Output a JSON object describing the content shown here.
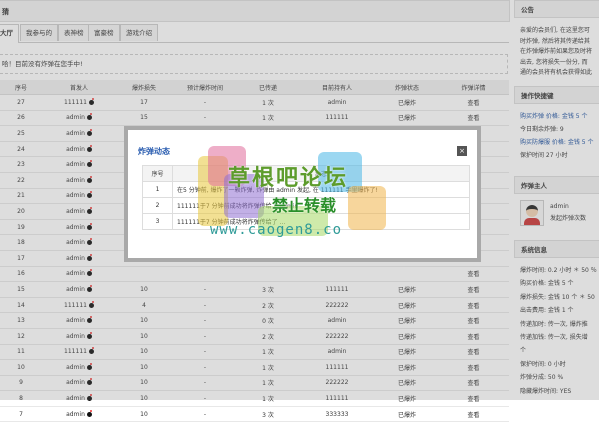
{
  "main": {
    "header": "猜",
    "tabs": [
      "大厅",
      "我参与的",
      "表神榜",
      "富豪榜",
      "游戏介绍"
    ],
    "notice": "哈！目前没有炸弹在您手中!",
    "columns": [
      "序号",
      "首发人",
      "爆炸损失",
      "预计爆炸时间",
      "已传递",
      "目前持有人",
      "炸弹状态",
      "炸弹详情"
    ],
    "rows": [
      {
        "id": "27",
        "starter": "111111",
        "loss": "17",
        "time": "-",
        "passed": "1 次",
        "holder": "admin",
        "status": "已爆炸",
        "detail": "查看"
      },
      {
        "id": "26",
        "starter": "admin",
        "loss": "15",
        "time": "-",
        "passed": "1 次",
        "holder": "111111",
        "status": "已爆炸",
        "detail": "查看"
      },
      {
        "id": "25",
        "starter": "admin",
        "loss": "",
        "time": "",
        "passed": "",
        "holder": "",
        "status": "",
        "detail": "查看"
      },
      {
        "id": "24",
        "starter": "admin",
        "loss": "",
        "time": "",
        "passed": "",
        "holder": "",
        "status": "",
        "detail": "查看"
      },
      {
        "id": "23",
        "starter": "admin",
        "loss": "",
        "time": "",
        "passed": "",
        "holder": "",
        "status": "",
        "detail": "查看"
      },
      {
        "id": "22",
        "starter": "admin",
        "loss": "",
        "time": "",
        "passed": "",
        "holder": "",
        "status": "",
        "detail": "查看"
      },
      {
        "id": "21",
        "starter": "admin",
        "loss": "",
        "time": "",
        "passed": "",
        "holder": "",
        "status": "",
        "detail": "查看"
      },
      {
        "id": "20",
        "starter": "admin",
        "loss": "",
        "time": "",
        "passed": "",
        "holder": "",
        "status": "",
        "detail": "查看"
      },
      {
        "id": "19",
        "starter": "admin",
        "loss": "",
        "time": "",
        "passed": "",
        "holder": "",
        "status": "",
        "detail": "查看"
      },
      {
        "id": "18",
        "starter": "admin",
        "loss": "",
        "time": "",
        "passed": "",
        "holder": "",
        "status": "",
        "detail": "查看"
      },
      {
        "id": "17",
        "starter": "admin",
        "loss": "",
        "time": "",
        "passed": "",
        "holder": "",
        "status": "",
        "detail": "查看"
      },
      {
        "id": "16",
        "starter": "admin",
        "loss": "",
        "time": "",
        "passed": "",
        "holder": "",
        "status": "",
        "detail": "查看"
      },
      {
        "id": "15",
        "starter": "admin",
        "loss": "10",
        "time": "-",
        "passed": "3 次",
        "holder": "111111",
        "status": "已爆炸",
        "detail": "查看"
      },
      {
        "id": "14",
        "starter": "111111",
        "loss": "4",
        "time": "-",
        "passed": "2 次",
        "holder": "222222",
        "status": "已爆炸",
        "detail": "查看"
      },
      {
        "id": "13",
        "starter": "admin",
        "loss": "10",
        "time": "-",
        "passed": "0 次",
        "holder": "admin",
        "status": "已爆炸",
        "detail": "查看"
      },
      {
        "id": "12",
        "starter": "admin",
        "loss": "10",
        "time": "-",
        "passed": "2 次",
        "holder": "222222",
        "status": "已爆炸",
        "detail": "查看"
      },
      {
        "id": "11",
        "starter": "111111",
        "loss": "10",
        "time": "-",
        "passed": "1 次",
        "holder": "admin",
        "status": "已爆炸",
        "detail": "查看"
      },
      {
        "id": "10",
        "starter": "admin",
        "loss": "10",
        "time": "-",
        "passed": "1 次",
        "holder": "111111",
        "status": "已爆炸",
        "detail": "查看"
      },
      {
        "id": "9",
        "starter": "admin",
        "loss": "10",
        "time": "-",
        "passed": "1 次",
        "holder": "222222",
        "status": "已爆炸",
        "detail": "查看"
      },
      {
        "id": "8",
        "starter": "admin",
        "loss": "10",
        "time": "-",
        "passed": "1 次",
        "holder": "111111",
        "status": "已爆炸",
        "detail": "查看"
      },
      {
        "id": "7",
        "starter": "admin",
        "loss": "10",
        "time": "-",
        "passed": "3 次",
        "holder": "333333",
        "status": "已爆炸",
        "detail": "查看"
      }
    ]
  },
  "side": {
    "announce_title": "公告",
    "announce_lines": [
      "亲爱的会员们, 在这里您可",
      "时炸弹, 然后将其传递给其",
      "在炸弹爆炸前如果您及时将",
      "出去, 您将损失一份分, 而",
      "通的会员将有机会获得如此"
    ],
    "quick_title": "操作快捷键",
    "quick_lines": [
      "购买炸弹 价格: 金钱 5 个",
      "今日剩余炸弹: 9",
      "购买防爆服 价格: 金钱 5 个",
      "保护时间 27 小时"
    ],
    "quick_links": [
      "购买炸弹",
      "购买防爆服"
    ],
    "holder_title": "炸弹主人",
    "holder_name": "admin",
    "holder_sub": "发起炸弹次数",
    "sys_title": "系统信息",
    "sys_lines": [
      "爆炸时间: 0.2 小时 ＊ 50 ％",
      "购买价格: 金钱 5 个",
      "爆炸损失: 金钱 10 个 ＊ 50",
      "出击费用: 金钱 1 个",
      "传递加时: 传一次, 爆炸推",
      "传递加钱: 传一次, 损失增",
      "个",
      "保护时间: 0 小时",
      "炸弹分成: 50 %",
      "隐藏爆炸时间: YES"
    ]
  },
  "dialog": {
    "title": "炸弹动态",
    "columns": [
      "序号",
      "动态"
    ],
    "rows": [
      {
        "no": "1",
        "text": "在5 分钟前, 爆炸了一颗炸弹, 炸弹由 admin 发起, 在 111111 手里爆炸了!"
      },
      {
        "no": "2",
        "text": "111111于7 分钟前成功将炸弹传给了 admin"
      },
      {
        "no": "3",
        "text": "111111于7 分钟前成功将炸弹传给了 ..."
      }
    ]
  },
  "watermark": {
    "line1": "草根吧论坛",
    "line2": "禁止转载",
    "line3": "www.caogen8.co"
  }
}
